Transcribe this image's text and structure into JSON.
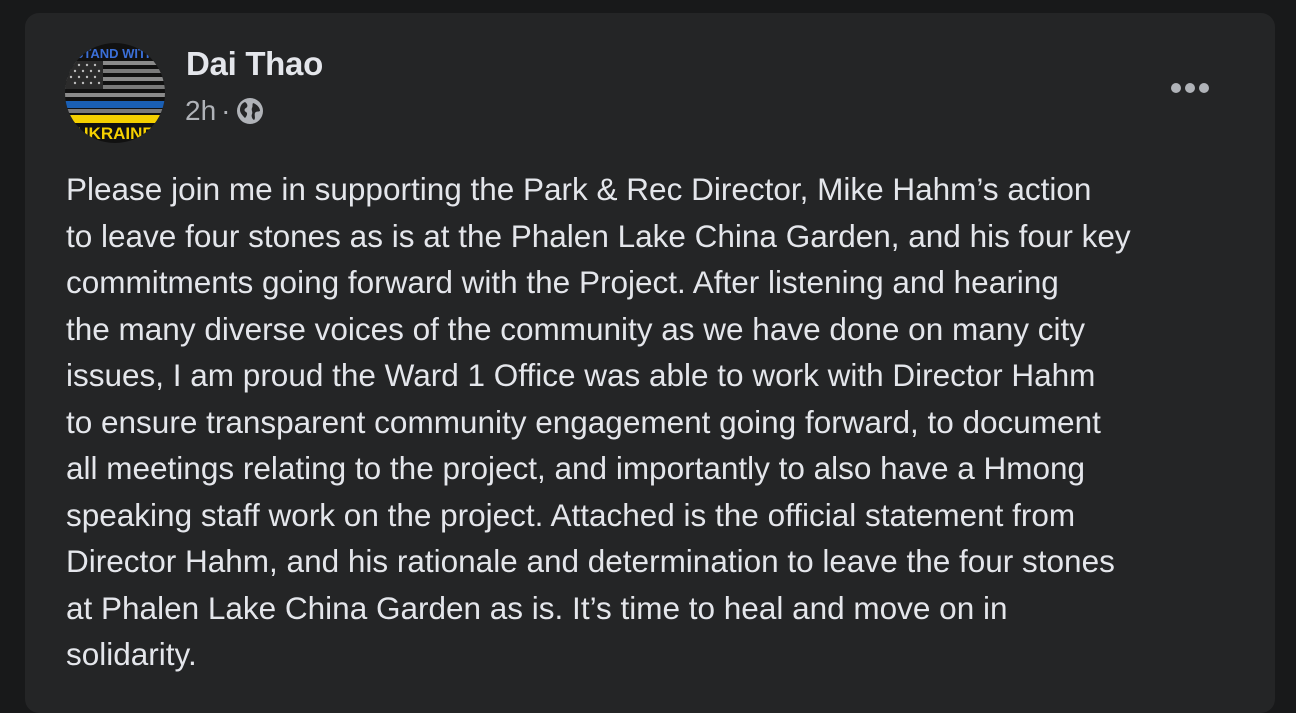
{
  "post": {
    "author": "Dai Thao",
    "timestamp": "2h",
    "separator": "·",
    "privacy_icon": "globe-icon",
    "avatar": {
      "label_top": "STAND WITH",
      "label_bottom": "UKRAINE"
    },
    "more_icon": "more-options-icon",
    "text": "Please join me in supporting the Park & Rec Director, Mike Hahm’s action\nto leave four stones as is at the Phalen Lake China Garden, and his four key\ncommitments going forward with the Project. After listening and hearing\nthe many diverse voices of the community as we have done on many city\nissues, I am proud the Ward 1 Office was able to work with Director Hahm\nto ensure transparent community engagement going forward, to document\nall meetings relating to the project, and importantly to also have a Hmong\nspeaking staff work on the project. Attached is the official statement from\nDirector Hahm, and his rationale and determination to leave the four stones\nat Phalen Lake China Garden as is. It’s time to heal and move on in\nsolidarity."
  },
  "colors": {
    "page_background": "#18191a",
    "card_background": "#242526",
    "primary_text": "#e4e6eb",
    "secondary_text": "#b0b3b8",
    "ukraine_blue": "#1a5fb4",
    "ukraine_yellow": "#f5d000"
  }
}
